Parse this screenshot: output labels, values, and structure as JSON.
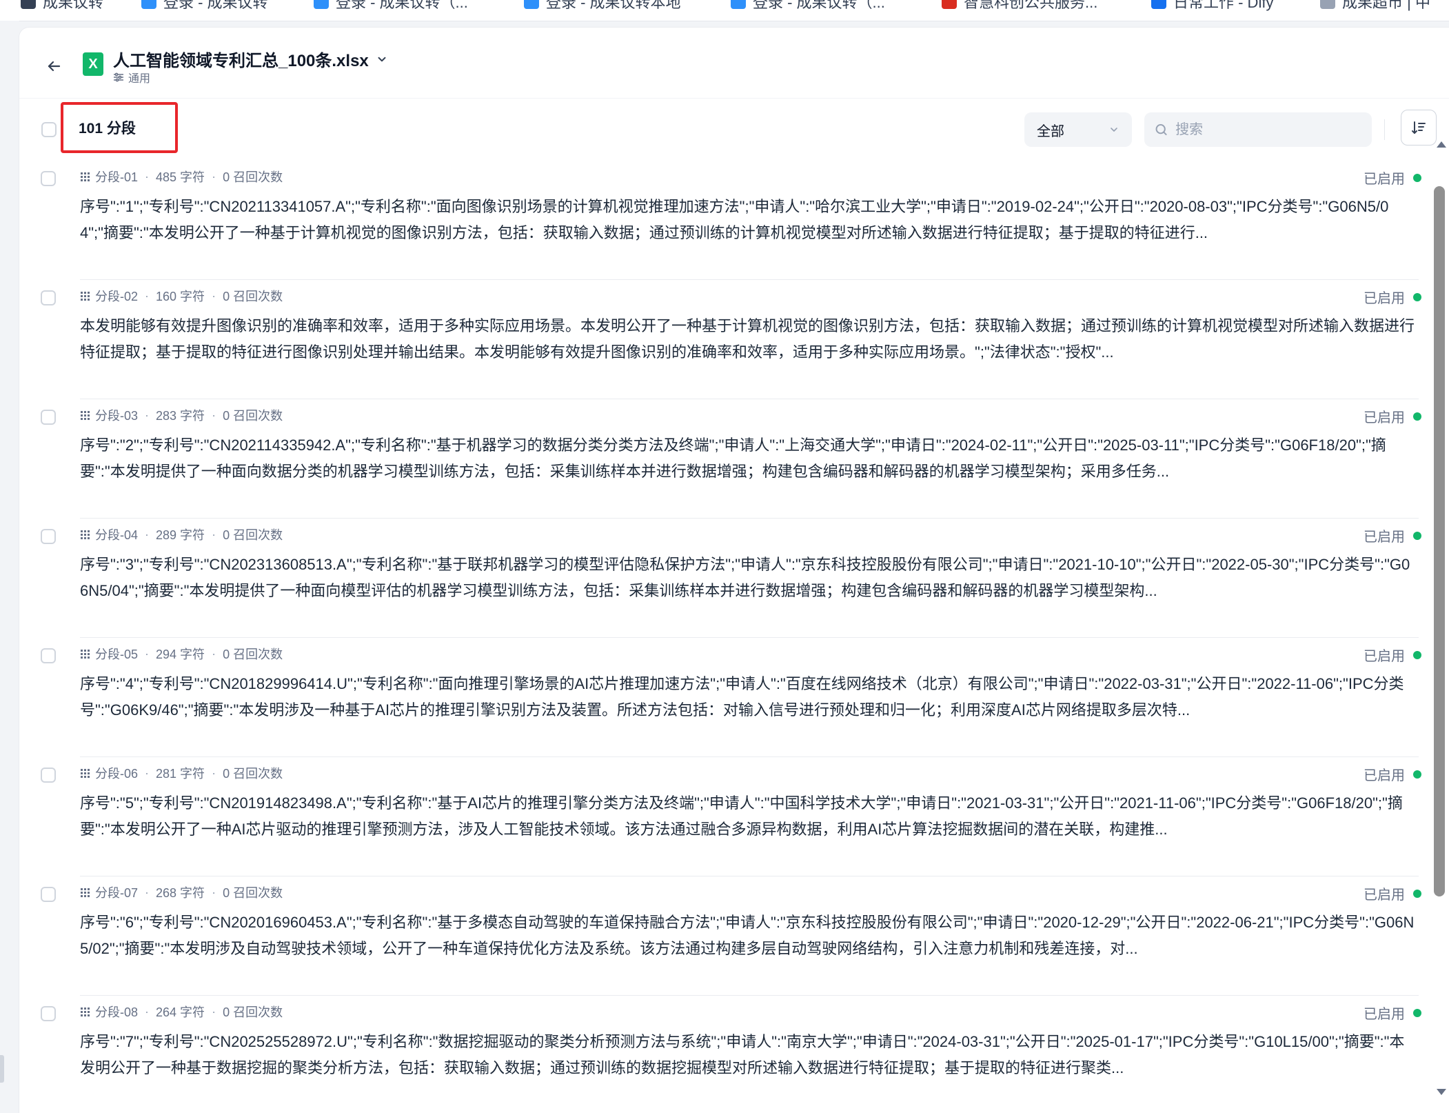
{
  "bookmarks": [
    {
      "label": "成果议转",
      "color": "#344054"
    },
    {
      "label": "登录 - 成果议转",
      "color": "#2e90fa"
    },
    {
      "label": "登录 - 成果议转（...",
      "color": "#2e90fa"
    },
    {
      "label": "登录 - 成果议转本地",
      "color": "#2e90fa"
    },
    {
      "label": "登录 - 成果议转（...",
      "color": "#2e90fa"
    },
    {
      "label": "智慧科创公共服务...",
      "color": "#d92d20"
    },
    {
      "label": "日常工作 - Dify",
      "color": "#1570ef"
    },
    {
      "label": "成果超市 | 中",
      "color": "#98a2b3"
    }
  ],
  "header": {
    "file_icon_text": "X",
    "file_name": "人工智能领域专利汇总_100条.xlsx",
    "file_mode": "通用"
  },
  "toolbar": {
    "segment_count": "101 分段",
    "filter_value": "全部",
    "search_placeholder": "搜索"
  },
  "segments": [
    {
      "id": "分段-01",
      "chars": "485 字符",
      "recalls": "0 召回次数",
      "status": "已启用",
      "text": "序号\":\"1\";\"专利号\":\"CN202113341057.A\";\"专利名称\":\"面向图像识别场景的计算机视觉推理加速方法\";\"申请人\":\"哈尔滨工业大学\";\"申请日\":\"2019-02-24\";\"公开日\":\"2020-08-03\";\"IPC分类号\":\"G06N5/04\";\"摘要\":\"本发明公开了一种基于计算机视觉的图像识别方法，包括：获取输入数据；通过预训练的计算机视觉模型对所述输入数据进行特征提取；基于提取的特征进行..."
    },
    {
      "id": "分段-02",
      "chars": "160 字符",
      "recalls": "0 召回次数",
      "status": "已启用",
      "text": "本发明能够有效提升图像识别的准确率和效率，适用于多种实际应用场景。本发明公开了一种基于计算机视觉的图像识别方法，包括：获取输入数据；通过预训练的计算机视觉模型对所述输入数据进行特征提取；基于提取的特征进行图像识别处理并输出结果。本发明能够有效提升图像识别的准确率和效率，适用于多种实际应用场景。\";\"法律状态\":\"授权\"..."
    },
    {
      "id": "分段-03",
      "chars": "283 字符",
      "recalls": "0 召回次数",
      "status": "已启用",
      "text": "序号\":\"2\";\"专利号\":\"CN202114335942.A\";\"专利名称\":\"基于机器学习的数据分类分类方法及终端\";\"申请人\":\"上海交通大学\";\"申请日\":\"2024-02-11\";\"公开日\":\"2025-03-11\";\"IPC分类号\":\"G06F18/20\";\"摘要\":\"本发明提供了一种面向数据分类的机器学习模型训练方法，包括：采集训练样本并进行数据增强；构建包含编码器和解码器的机器学习模型架构；采用多任务..."
    },
    {
      "id": "分段-04",
      "chars": "289 字符",
      "recalls": "0 召回次数",
      "status": "已启用",
      "text": "序号\":\"3\";\"专利号\":\"CN202313608513.A\";\"专利名称\":\"基于联邦机器学习的模型评估隐私保护方法\";\"申请人\":\"京东科技控股股份有限公司\";\"申请日\":\"2021-10-10\";\"公开日\":\"2022-05-30\";\"IPC分类号\":\"G06N5/04\";\"摘要\":\"本发明提供了一种面向模型评估的机器学习模型训练方法，包括：采集训练样本并进行数据增强；构建包含编码器和解码器的机器学习模型架构..."
    },
    {
      "id": "分段-05",
      "chars": "294 字符",
      "recalls": "0 召回次数",
      "status": "已启用",
      "text": "序号\":\"4\";\"专利号\":\"CN201829996414.U\";\"专利名称\":\"面向推理引擎场景的AI芯片推理加速方法\";\"申请人\":\"百度在线网络技术（北京）有限公司\";\"申请日\":\"2022-03-31\";\"公开日\":\"2022-11-06\";\"IPC分类号\":\"G06K9/46\";\"摘要\":\"本发明涉及一种基于AI芯片的推理引擎识别方法及装置。所述方法包括：对输入信号进行预处理和归一化；利用深度AI芯片网络提取多层次特..."
    },
    {
      "id": "分段-06",
      "chars": "281 字符",
      "recalls": "0 召回次数",
      "status": "已启用",
      "text": "序号\":\"5\";\"专利号\":\"CN201914823498.A\";\"专利名称\":\"基于AI芯片的推理引擎分类方法及终端\";\"申请人\":\"中国科学技术大学\";\"申请日\":\"2021-03-31\";\"公开日\":\"2021-11-06\";\"IPC分类号\":\"G06F18/20\";\"摘要\":\"本发明公开了一种AI芯片驱动的推理引擎预测方法，涉及人工智能技术领域。该方法通过融合多源异构数据，利用AI芯片算法挖掘数据间的潜在关联，构建推..."
    },
    {
      "id": "分段-07",
      "chars": "268 字符",
      "recalls": "0 召回次数",
      "status": "已启用",
      "text": "序号\":\"6\";\"专利号\":\"CN202016960453.A\";\"专利名称\":\"基于多模态自动驾驶的车道保持融合方法\";\"申请人\":\"京东科技控股股份有限公司\";\"申请日\":\"2020-12-29\";\"公开日\":\"2022-06-21\";\"IPC分类号\":\"G06N5/02\";\"摘要\":\"本发明涉及自动驾驶技术领域，公开了一种车道保持优化方法及系统。该方法通过构建多层自动驾驶网络结构，引入注意力机制和残差连接，对..."
    },
    {
      "id": "分段-08",
      "chars": "264 字符",
      "recalls": "0 召回次数",
      "status": "已启用",
      "text": "序号\":\"7\";\"专利号\":\"CN202525528972.U\";\"专利名称\":\"数据挖掘驱动的聚类分析预测方法与系统\";\"申请人\":\"南京大学\";\"申请日\":\"2024-03-31\";\"公开日\":\"2025-01-17\";\"IPC分类号\":\"G10L15/00\";\"摘要\":\"本发明公开了一种基于数据挖掘的聚类分析方法，包括：获取输入数据；通过预训练的数据挖掘模型对所述输入数据进行特征提取；基于提取的特征进行聚类..."
    }
  ]
}
